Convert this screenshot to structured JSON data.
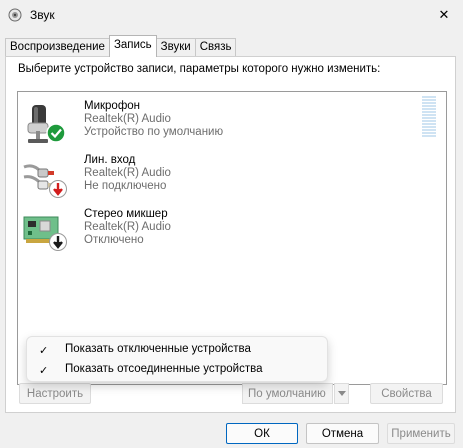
{
  "window": {
    "title": "Звук",
    "close_glyph": "✕"
  },
  "tabs": [
    {
      "label": "Воспроизведение"
    },
    {
      "label": "Запись",
      "active": true
    },
    {
      "label": "Звуки"
    },
    {
      "label": "Связь"
    }
  ],
  "instruction": "Выберите устройство записи, параметры которого нужно изменить:",
  "devices": [
    {
      "name": "Микрофон",
      "driver": "Realtek(R) Audio",
      "status": "Устройство по умолчанию",
      "icon": "microphone-icon",
      "badge": "green-check"
    },
    {
      "name": "Лин. вход",
      "driver": "Realtek(R) Audio",
      "status": "Не подключено",
      "icon": "line-in-jack-icon",
      "badge": "red-down-arrow"
    },
    {
      "name": "Стерео микшер",
      "driver": "Realtek(R) Audio",
      "status": "Отключено",
      "icon": "sound-card-icon",
      "badge": "black-down-arrow"
    }
  ],
  "context_menu": [
    {
      "check": "✓",
      "label": "Показать отключенные устройства"
    },
    {
      "check": "✓",
      "label": "Показать отсоединенные устройства"
    }
  ],
  "buttons": {
    "configure": "Настроить",
    "set_default": "По умолчанию",
    "properties": "Свойства",
    "ok": "ОК",
    "cancel": "Отмена",
    "apply": "Применить"
  },
  "colors": {
    "accent": "#0067c0",
    "check_green": "#1e9a3c",
    "disabled_text": "#8a8a8a"
  }
}
